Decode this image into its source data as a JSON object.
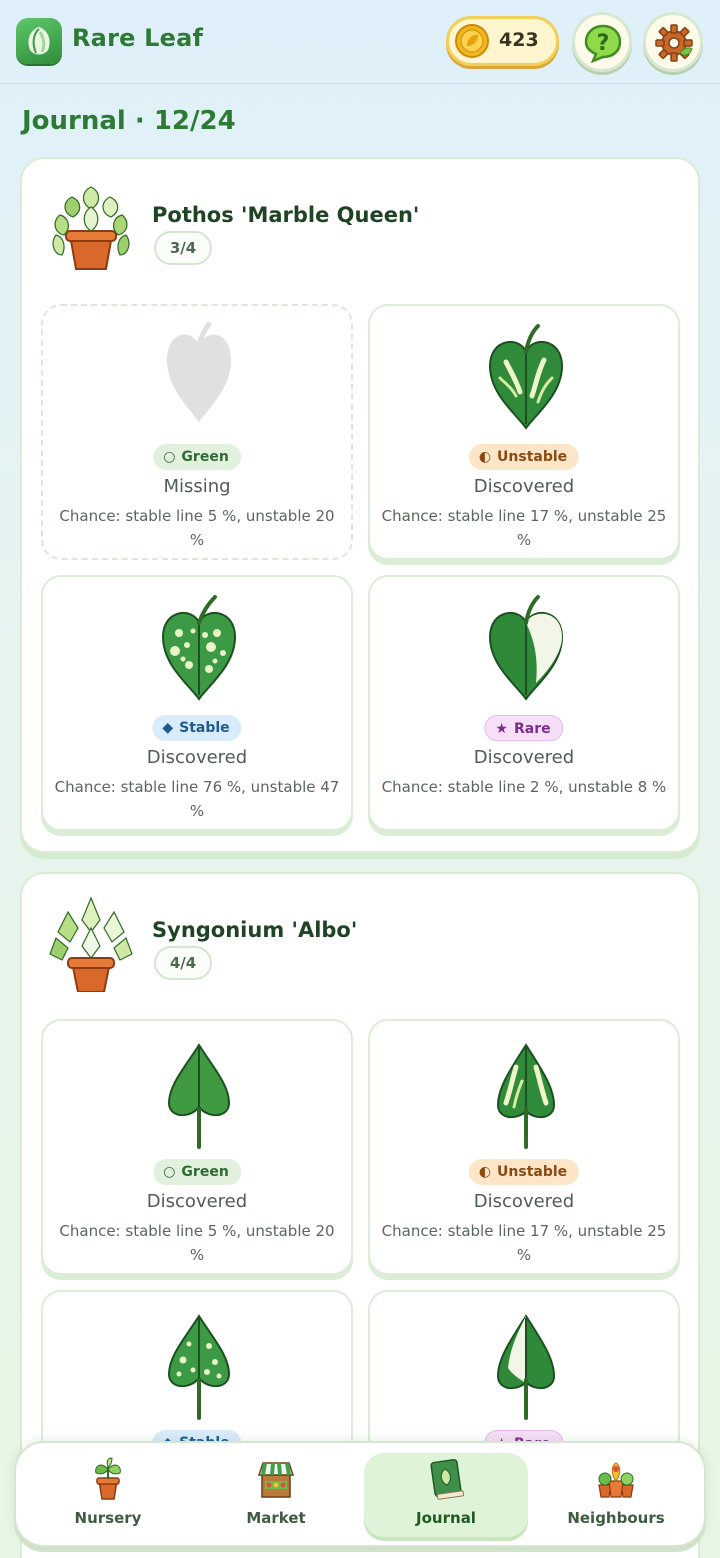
{
  "header": {
    "app_title": "Rare Leaf",
    "coins": "423",
    "icons": {
      "logo": "leaf-logo-icon",
      "coin": "coin-icon",
      "help": "help-icon",
      "settings": "gear-icon"
    }
  },
  "journal": {
    "title": "Journal · 12/24"
  },
  "plants": [
    {
      "name": "Pothos 'Marble Queen'",
      "progress": "3/4",
      "variants": [
        {
          "badge": "Green",
          "status": "Missing",
          "chance": "Chance: stable line 5 %, unstable 20 %"
        },
        {
          "badge": "Unstable",
          "status": "Discovered",
          "chance": "Chance: stable line 17 %, unstable 25 %"
        },
        {
          "badge": "Stable",
          "status": "Discovered",
          "chance": "Chance: stable line 76 %, unstable 47 %"
        },
        {
          "badge": "Rare",
          "status": "Discovered",
          "chance": "Chance: stable line 2 %, unstable 8 %"
        }
      ]
    },
    {
      "name": "Syngonium 'Albo'",
      "progress": "4/4",
      "variants": [
        {
          "badge": "Green",
          "status": "Discovered",
          "chance": "Chance: stable line 5 %, unstable 20 %"
        },
        {
          "badge": "Unstable",
          "status": "Discovered",
          "chance": "Chance: stable line 17 %, unstable 25 %"
        },
        {
          "badge": "Stable",
          "status": "",
          "chance": ""
        },
        {
          "badge": "Rare",
          "status": "",
          "chance": ""
        }
      ]
    }
  ],
  "nav": [
    {
      "label": "Nursery",
      "icon": "potted-plant-icon"
    },
    {
      "label": "Market",
      "icon": "market-stall-icon"
    },
    {
      "label": "Journal",
      "icon": "journal-book-icon",
      "active": true
    },
    {
      "label": "Neighbours",
      "icon": "neighbours-plants-icon"
    }
  ],
  "colors": {
    "accent_green": "#2d7a34",
    "coin_gold": "#f2cf5a",
    "active_tab": "#dff3d8"
  }
}
